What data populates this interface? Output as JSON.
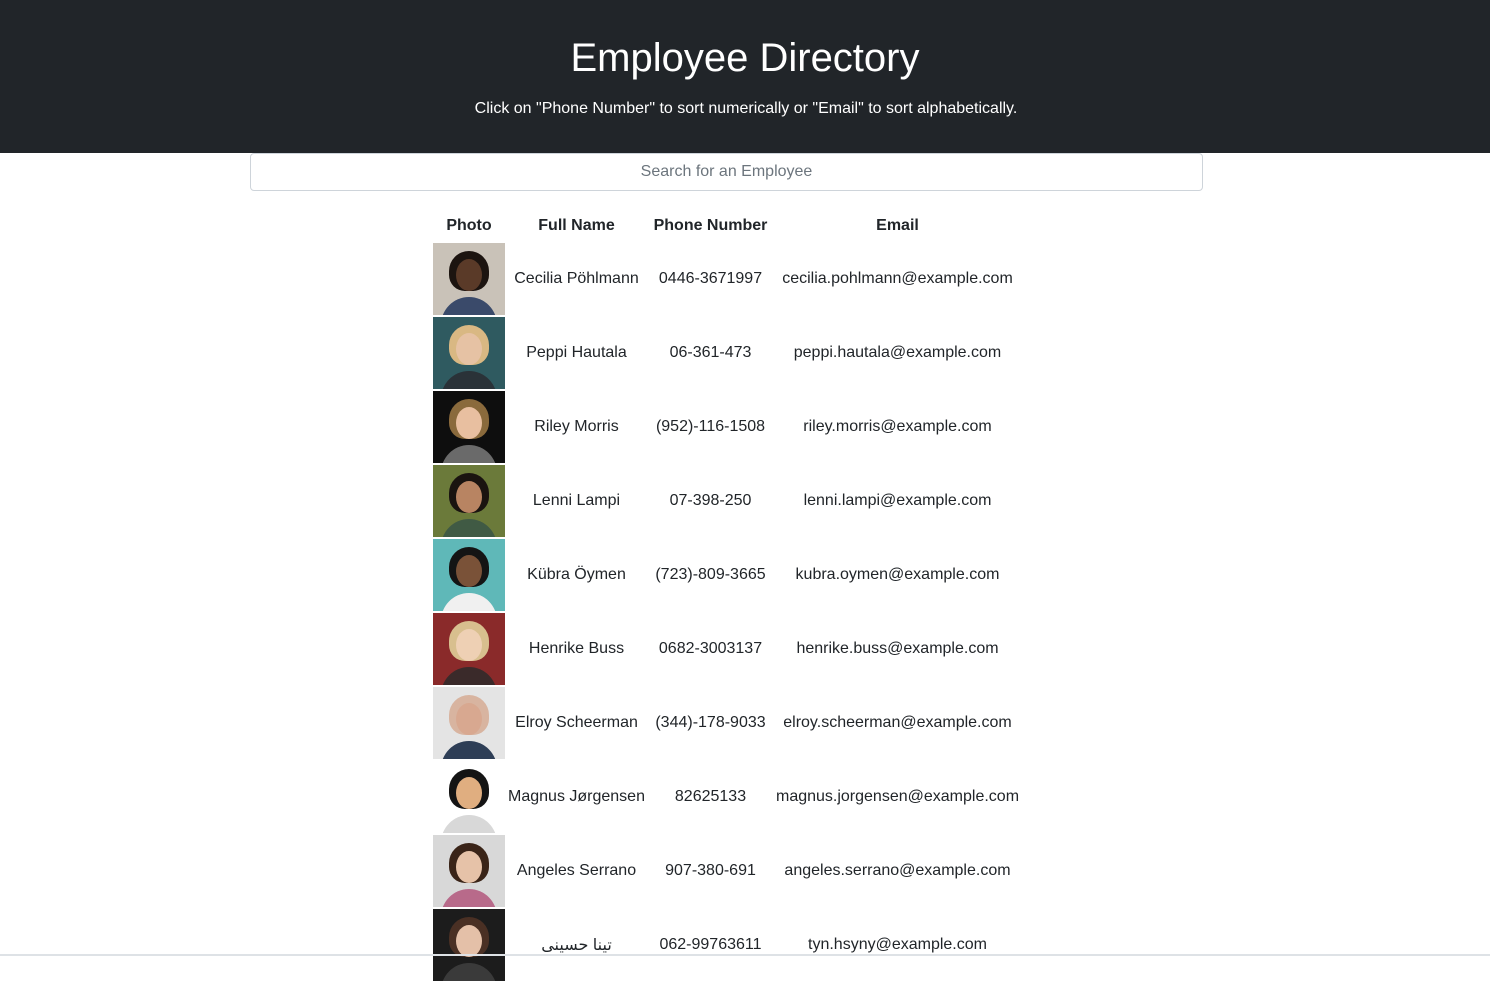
{
  "header": {
    "title": "Employee Directory",
    "subtitle": "Click on \"Phone Number\" to sort numerically or \"Email\" to sort alphabetically."
  },
  "search": {
    "placeholder": "Search for an Employee",
    "value": ""
  },
  "table": {
    "columns": [
      "Photo",
      "Full Name",
      "Phone Number",
      "Email"
    ],
    "rows": [
      {
        "name": "Cecilia Pöhlmann",
        "phone": "0446-3671997",
        "email": "cecilia.pohlmann@example.com",
        "photo": {
          "bg": "#c9c2b8",
          "hair": "#1c1410",
          "face": "#5a3a28",
          "body": "#3a4a6a"
        }
      },
      {
        "name": "Peppi Hautala",
        "phone": "06-361-473",
        "email": "peppi.hautala@example.com",
        "photo": {
          "bg": "#2f5a60",
          "hair": "#d9b883",
          "face": "#e6c2a4",
          "body": "#2a3238"
        }
      },
      {
        "name": "Riley Morris",
        "phone": "(952)-116-1508",
        "email": "riley.morris@example.com",
        "photo": {
          "bg": "#0e0e0e",
          "hair": "#8a6a3c",
          "face": "#e8bfa0",
          "body": "#6a6a6a"
        }
      },
      {
        "name": "Lenni Lampi",
        "phone": "07-398-250",
        "email": "lenni.lampi@example.com",
        "photo": {
          "bg": "#6b7a3a",
          "hair": "#1a1410",
          "face": "#b88462",
          "body": "#405a44"
        }
      },
      {
        "name": "Kübra Öymen",
        "phone": "(723)-809-3665",
        "email": "kubra.oymen@example.com",
        "photo": {
          "bg": "#5fb8b8",
          "hair": "#141414",
          "face": "#7a5238",
          "body": "#f0f0f0"
        }
      },
      {
        "name": "Henrike Buss",
        "phone": "0682-3003137",
        "email": "henrike.buss@example.com",
        "photo": {
          "bg": "#8a2a2a",
          "hair": "#d8bf8e",
          "face": "#eed0b4",
          "body": "#3a2a2a"
        }
      },
      {
        "name": "Elroy Scheerman",
        "phone": "(344)-178-9033",
        "email": "elroy.scheerman@example.com",
        "photo": {
          "bg": "#e4e4e4",
          "hair": "#d8b4a0",
          "face": "#d8a890",
          "body": "#2e3e56"
        }
      },
      {
        "name": "Magnus Jørgensen",
        "phone": "82625133",
        "email": "magnus.jorgensen@example.com",
        "photo": {
          "bg": "#ffffff",
          "hair": "#141414",
          "face": "#e0ae80",
          "body": "#d8d8d8"
        }
      },
      {
        "name": "Angeles Serrano",
        "phone": "907-380-691",
        "email": "angeles.serrano@example.com",
        "photo": {
          "bg": "#d8d8d8",
          "hair": "#3a2418",
          "face": "#e6c2a8",
          "body": "#b86a8a"
        }
      },
      {
        "name": "تينا حسینی",
        "phone": "062-99763611",
        "email": "tyn.hsyny@example.com",
        "photo": {
          "bg": "#1c1c1c",
          "hair": "#4a3024",
          "face": "#e4c0a8",
          "body": "#3a3a3a"
        }
      }
    ]
  },
  "colors": {
    "header_bg": "#212529",
    "header_text": "#ffffff",
    "body_text": "#212529",
    "input_border": "#ced4da"
  }
}
